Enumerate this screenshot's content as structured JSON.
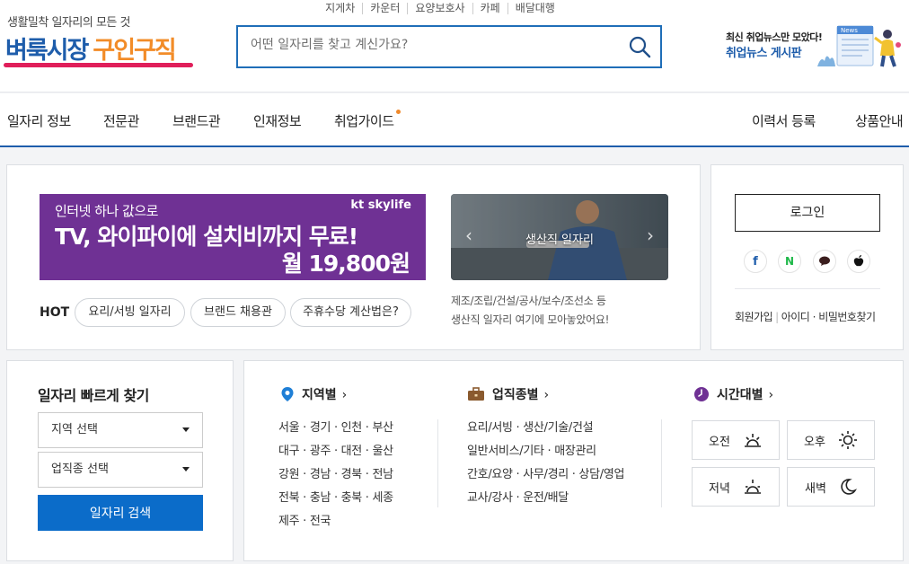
{
  "header": {
    "tagline": "생활밀착 일자리의 모든 것",
    "logo_main": "벼룩시장",
    "logo_sub": "구인구직",
    "top_links": [
      "지게차",
      "카운터",
      "요양보호사",
      "카페",
      "배달대행"
    ],
    "search_placeholder": "어떤 일자리를 찾고 계신가요?",
    "news_line1": "최신 취업뉴스만 모았다!",
    "news_line2": "취업뉴스 게시판",
    "news_icon_text": "News"
  },
  "nav": {
    "items": [
      "일자리 정보",
      "전문관",
      "브랜드관",
      "인재정보",
      "취업가이드"
    ],
    "right": [
      "이력서 등록",
      "상품안내"
    ]
  },
  "banner": {
    "line1": "인터넷 하나 값으로",
    "line2": "TV, 와이파이에 설치비까지 무료!",
    "line3": "월 19,800원",
    "brand": "kt skylife"
  },
  "hot": {
    "label": "HOT",
    "chips": [
      "요리/서빙 일자리",
      "브랜드 채용관",
      "주휴수당 계산법은?"
    ]
  },
  "photo": {
    "caption": "생산직 일자리",
    "desc1": "제조/조립/건설/공사/보수/조선소 등",
    "desc2": "생산직 일자리 여기에 모아놓았어요!"
  },
  "login": {
    "button": "로그인",
    "links": [
      "회원가입",
      "아이디 · 비밀번호찾기"
    ]
  },
  "quick": {
    "title": "일자리 빠르게 찾기",
    "region_select": "지역 선택",
    "job_select": "업직종 선택",
    "search_button": "일자리 검색"
  },
  "categories": {
    "region": {
      "title": "지역별",
      "rows": [
        "서울 · 경기 · 인천 · 부산",
        "대구 · 광주 · 대전 · 울산",
        "강원 · 경남 · 경북 · 전남",
        "전북 · 충남 · 충북 · 세종",
        "제주 · 전국"
      ]
    },
    "job": {
      "title": "업직종별",
      "rows": [
        "요리/서빙 · 생산/기술/건설",
        "일반서비스/기타 · 매장관리",
        "간호/요양 · 사무/경리 · 상담/영업",
        "교사/강사 · 운전/배달"
      ]
    },
    "time": {
      "title": "시간대별",
      "buttons": [
        "오전",
        "오후",
        "저녁",
        "새벽"
      ]
    }
  },
  "colors": {
    "brand_blue": "#1e5dab",
    "brand_orange": "#f28c28",
    "accent_pink": "#e01e5a",
    "banner_purple": "#6f3194",
    "button_blue": "#0b6cc9"
  }
}
